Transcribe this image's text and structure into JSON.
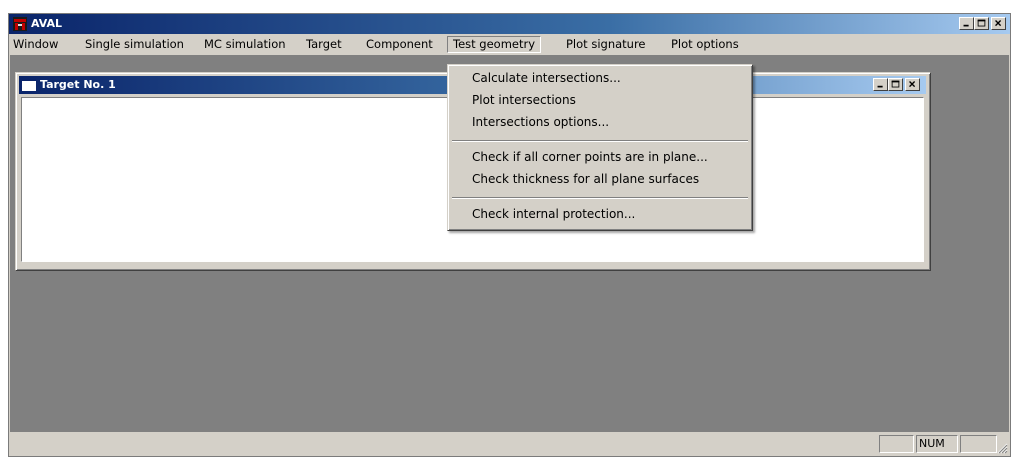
{
  "app": {
    "title": "AVAL"
  },
  "menu": {
    "items": [
      {
        "label": "Window"
      },
      {
        "label": "Single simulation"
      },
      {
        "label": "MC simulation"
      },
      {
        "label": "Target"
      },
      {
        "label": "Component"
      },
      {
        "label": "Test geometry"
      },
      {
        "label": "Plot signature"
      },
      {
        "label": "Plot options"
      }
    ],
    "open_menu": "Test geometry"
  },
  "dropdown": {
    "items": [
      {
        "label": "Calculate intersections..."
      },
      {
        "label": "Plot intersections"
      },
      {
        "label": "Intersections options..."
      },
      {
        "label": "Check if all corner points are in plane..."
      },
      {
        "label": "Check thickness for all plane surfaces"
      },
      {
        "label": "Check internal protection..."
      }
    ]
  },
  "child_window": {
    "title": "Target No. 1"
  },
  "statusbar": {
    "panels": [
      "",
      "NUM",
      ""
    ]
  },
  "colors": {
    "title_gradient_start": "#0a246a",
    "title_gradient_end": "#a6caf0",
    "face": "#d4d0c8",
    "mdi_background": "#808080"
  }
}
